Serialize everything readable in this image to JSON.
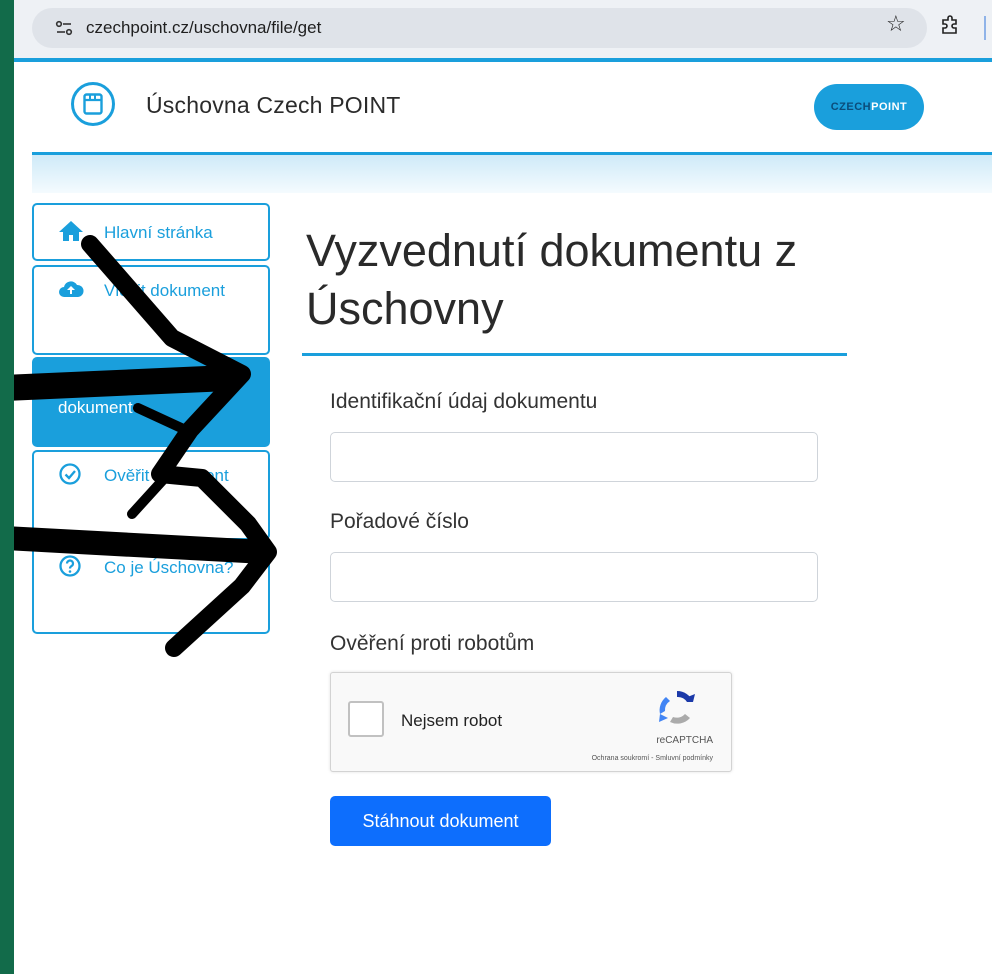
{
  "browser": {
    "url": "czechpoint.cz/uschovna/file/get",
    "star_icon": "star-icon",
    "extensions_icon": "puzzle-icon"
  },
  "header": {
    "app_title": "Úschovna Czech POINT",
    "logo_left": "CZECH",
    "logo_right": "POINT"
  },
  "sidebar": {
    "items": [
      {
        "label": "Hlavní stránka",
        "icon": "home-icon",
        "active": false
      },
      {
        "label": "Vložit dokument",
        "icon": "cloud-upload-icon",
        "active": false
      },
      {
        "label": "Vyzvednout dokument",
        "icon": "cloud-download-icon",
        "active": true
      },
      {
        "label": "Ověřit dokument",
        "icon": "check-circle-icon",
        "active": false
      },
      {
        "label": "Co je Úschovna?",
        "icon": "question-circle-icon",
        "active": false
      }
    ]
  },
  "main": {
    "title": "Vyzvednutí dokumentu z Úschovny",
    "field_id_label": "Identifikační údaj dokumentu",
    "field_id_value": "",
    "field_order_label": "Pořadové číslo",
    "field_order_value": "",
    "robot_label": "Ověření proti robotům",
    "download_button": "Stáhnout dokument"
  },
  "recaptcha": {
    "checkbox_label": "Nejsem robot",
    "brand": "reCAPTCHA",
    "terms": "Ochrana soukromí - Smluvní podmínky"
  },
  "colors": {
    "frame": "#126b4a",
    "accent": "#1a9fdc",
    "button": "#0d6efd"
  }
}
